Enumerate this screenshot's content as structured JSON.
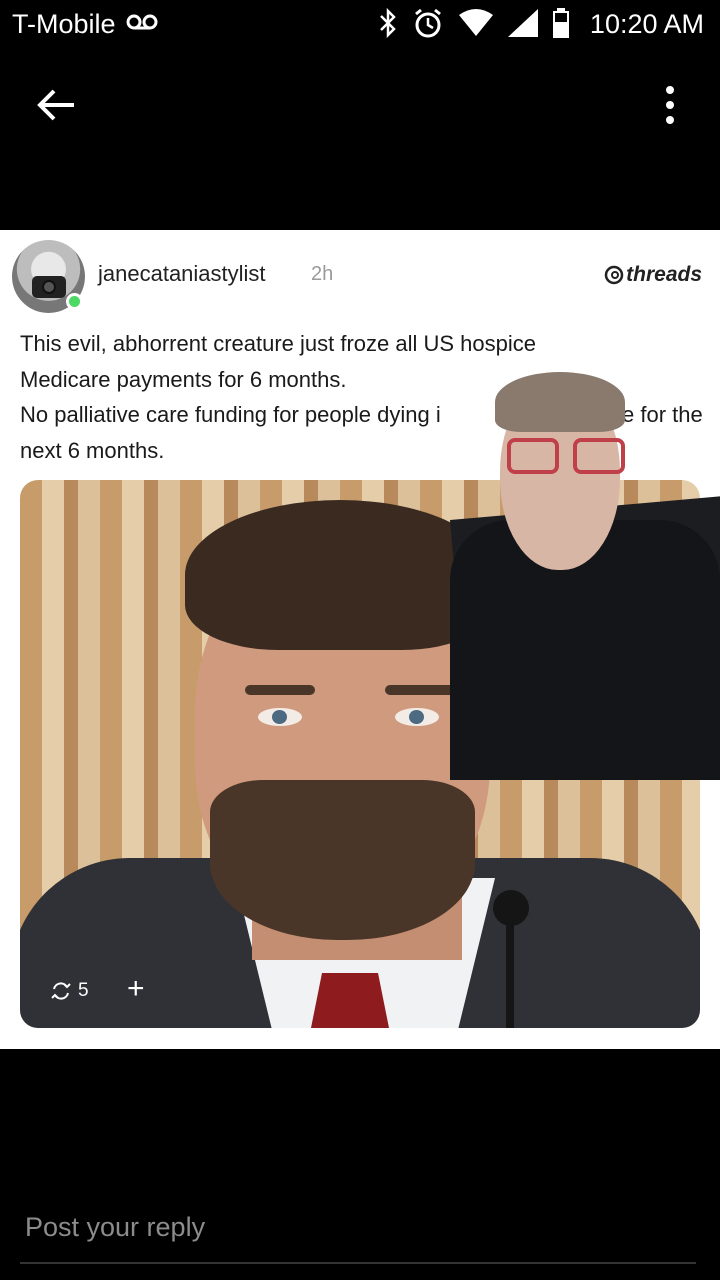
{
  "status_bar": {
    "carrier": "T-Mobile",
    "time": "10:20 AM",
    "icons": [
      "voicemail-icon",
      "bluetooth-icon",
      "alarm-icon",
      "wifi-icon",
      "signal-icon",
      "battery-icon"
    ]
  },
  "app_bar": {
    "back_icon": "arrow-left-icon",
    "menu_icon": "more-vertical-icon"
  },
  "post": {
    "username": "janecataniastylist",
    "time": "2h",
    "platform": "threads",
    "lines": [
      "This evil, abhorrent creature just froze all US hospice",
      "Medicare payments for 6 months.",
      "No palliative care funding for people dying i",
      "next 6 months."
    ],
    "line3_tail": "e for the",
    "repost_count": "5",
    "plus_label": "+"
  },
  "reply": {
    "placeholder": "Post your reply"
  },
  "colors": {
    "background": "#000000",
    "card": "#ffffff",
    "online": "#4cd964",
    "tie": "#8e1b1d"
  }
}
